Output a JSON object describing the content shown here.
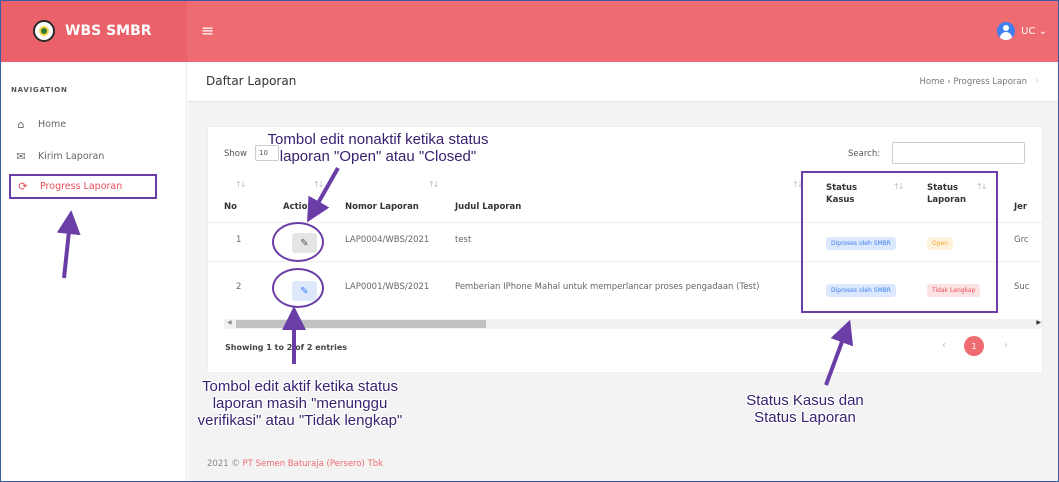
{
  "app": {
    "brand": "WBS SMBR",
    "user_label": "UC ⌄",
    "menu_glyph": "≡"
  },
  "sidebar": {
    "heading": "NAVIGATION",
    "items": [
      {
        "label": "Home",
        "icon": "home-icon",
        "glyph": "⌂"
      },
      {
        "label": "Kirim Laporan",
        "icon": "envelope-icon",
        "glyph": "✉"
      },
      {
        "label": "Progress Laporan",
        "icon": "refresh-icon",
        "glyph": "⟳",
        "active": true
      }
    ]
  },
  "page": {
    "title": "Daftar Laporan",
    "breadcrumb": "Home › Progress Laporan",
    "breadcrumb_end": "›"
  },
  "table_controls": {
    "show_label": "Show",
    "show_value": "10",
    "search_label": "Search:"
  },
  "table": {
    "columns": {
      "no": "No",
      "action": "Action",
      "nomor": "Nomor Laporan",
      "judul": "Judul Laporan",
      "status_kasus_1": "Status",
      "status_kasus_2": "Kasus",
      "status_laporan_1": "Status",
      "status_laporan_2": "Laporan",
      "jenis": "Jer"
    },
    "rows": [
      {
        "no": "1",
        "nomor": "LAP0004/WBS/2021",
        "judul": "test",
        "status_kasus": "Diproses oleh SMBR",
        "status_laporan": "Open",
        "jenis": "Grc",
        "edit_enabled": false
      },
      {
        "no": "2",
        "nomor": "LAP0001/WBS/2021",
        "judul": "Pemberian IPhone Mahal untuk memperlancar proses pengadaan (Test)",
        "status_kasus": "Diproses oleh SMBR",
        "status_laporan": "Tidak Lengkap",
        "jenis": "Suc",
        "edit_enabled": true
      }
    ],
    "edit_glyph": "✎",
    "sort_glyph": "↑↓",
    "scroll_left": "◀",
    "scroll_right": "▶"
  },
  "pagination": {
    "info": "Showing 1 to 2 of 2 entries",
    "prev": "‹",
    "current": "1",
    "next": "›"
  },
  "footer": {
    "text": "2021 © ",
    "company": "PT Semen Baturaja (Persero) Tbk"
  },
  "annotations": {
    "edit_disabled_note": [
      "Tombol edit nonaktif ketika status",
      "laporan \"Open\" atau \"Closed\""
    ],
    "edit_enabled_note": [
      "Tombol edit aktif ketika status",
      "laporan masih \"menunggu",
      "verifikasi\" atau \"Tidak lengkap\""
    ],
    "status_note": [
      "Status Kasus dan",
      "Status Laporan"
    ]
  },
  "colors": {
    "topbar": "#ef6b72",
    "accent": "#ea4b57",
    "annotation": "#6a3ea6",
    "link_blue": "#3f7ff0"
  }
}
